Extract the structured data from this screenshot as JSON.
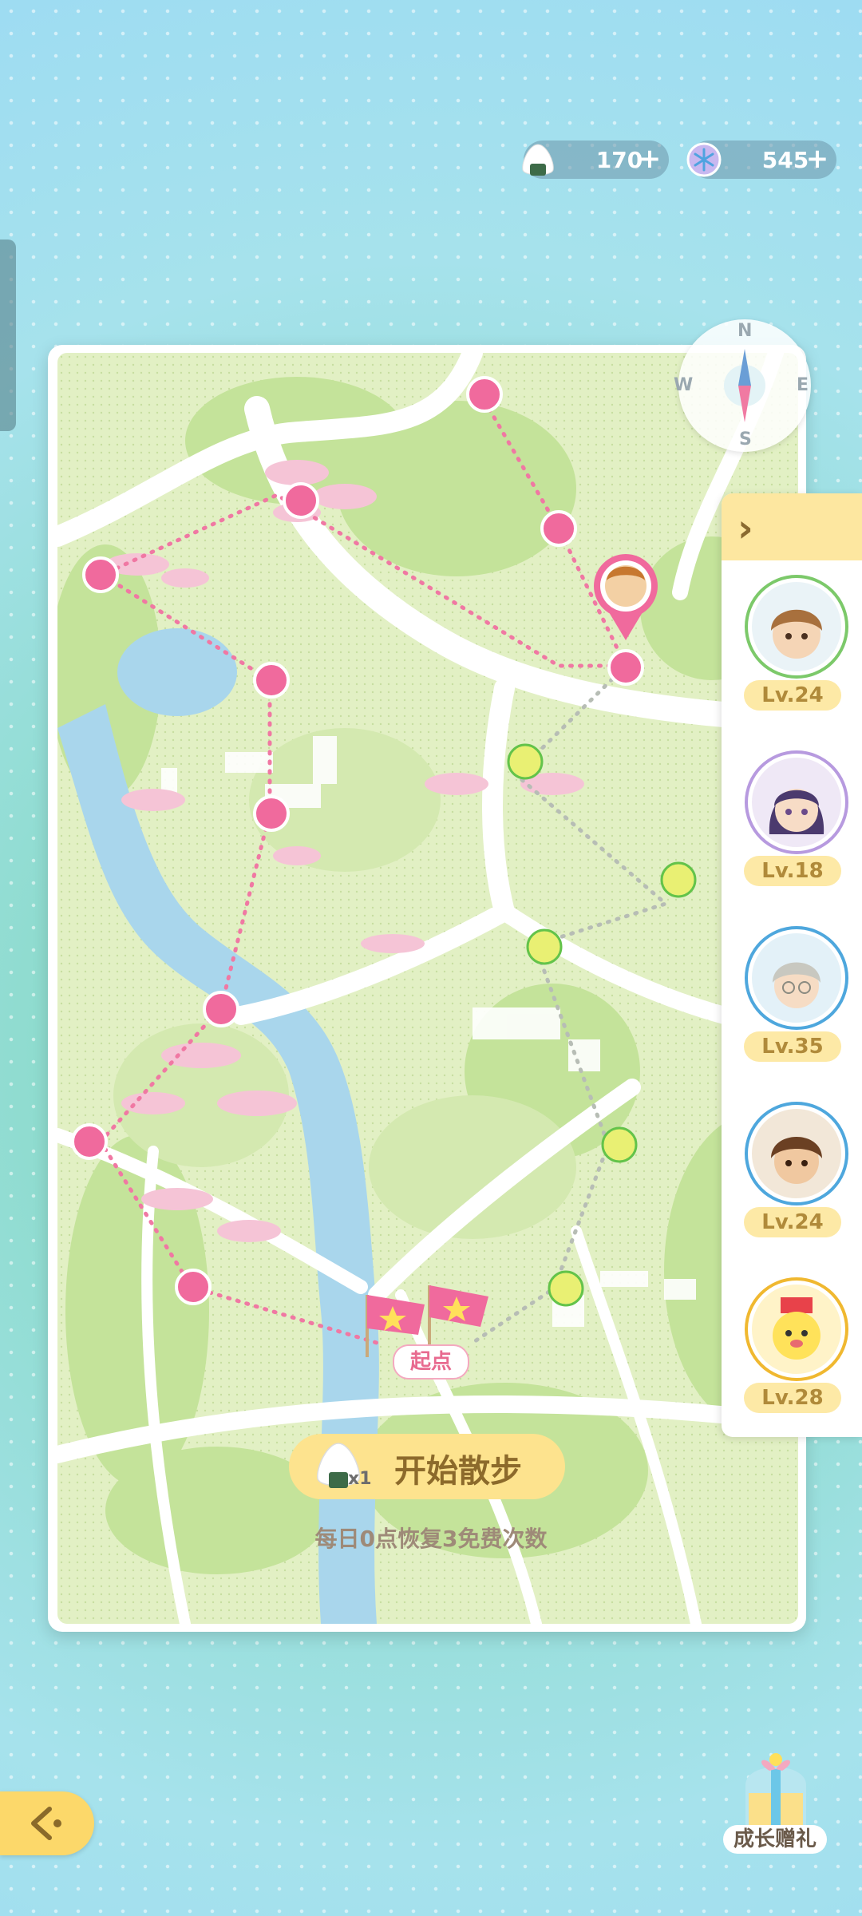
{
  "currencies": [
    {
      "icon": "rice-ball-icon",
      "value": "170"
    },
    {
      "icon": "snowflake-gem-icon",
      "value": "545"
    }
  ],
  "compass": {
    "n": "N",
    "e": "E",
    "s": "S",
    "w": "W"
  },
  "characters": [
    {
      "level": "Lv.24",
      "ring": "#7cc96a",
      "avatar": "boy-brown-hair"
    },
    {
      "level": "Lv.18",
      "ring": "#b79adf",
      "avatar": "girl-purple-hair"
    },
    {
      "level": "Lv.35",
      "ring": "#4ea7dd",
      "avatar": "boy-grey-hair"
    },
    {
      "level": "Lv.24",
      "ring": "#4ea7dd",
      "avatar": "boy-brown-hair-2"
    },
    {
      "level": "Lv.28",
      "ring": "#f0b830",
      "avatar": "yellow-mascot"
    }
  ],
  "map": {
    "start_marker": "起点"
  },
  "start_button": {
    "label": "开始散步",
    "cost": "x1"
  },
  "daily_note": "每日0点恢复3免费次数",
  "gift": {
    "label": "成长赠礼"
  }
}
